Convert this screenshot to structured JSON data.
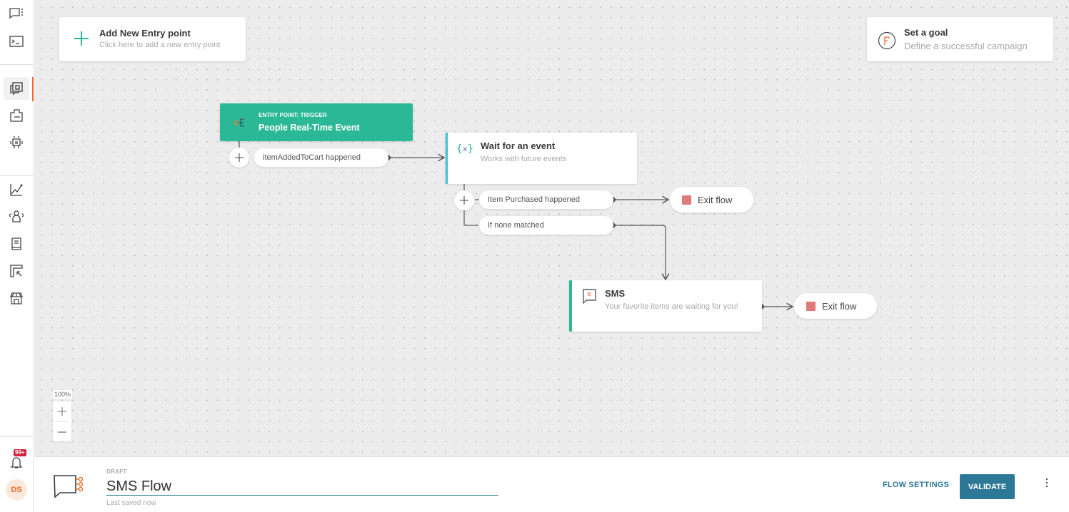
{
  "sidebar": {
    "items": [
      {
        "name": "chat-menu-icon"
      },
      {
        "name": "terminal-icon"
      },
      {
        "name": "journeys-icon",
        "active": true
      },
      {
        "name": "templates-icon"
      },
      {
        "name": "bot-icon"
      },
      {
        "name": "analytics-icon"
      },
      {
        "name": "people-icon"
      },
      {
        "name": "catalog-icon"
      },
      {
        "name": "import-icon"
      },
      {
        "name": "store-icon"
      }
    ],
    "notifications_badge": "99+",
    "avatar_initials": "DS",
    "accent": "#ef6a2c"
  },
  "canvas": {
    "add_entry": {
      "title": "Add New Entry point",
      "subtitle": "Click here to add a new entry point"
    },
    "goal": {
      "title": "Set a goal",
      "subtitle": "Define a successful campaign"
    },
    "trigger": {
      "label": "ENTRY POINT: TRIGGER",
      "title": "People Real-Time Event",
      "color": "#2bb896"
    },
    "trigger_branch": "itemAddedToCart happened",
    "wait_node": {
      "title": "Wait for an event",
      "subtitle": "Works with future events",
      "icon": "{×}"
    },
    "wait_branches": [
      "Item Purchased happened",
      "If none matched"
    ],
    "sms_node": {
      "title": "SMS",
      "subtitle": "Your favorite items are waiting for you!"
    },
    "exit_label": "Exit flow",
    "exit_color": "#e07b7b",
    "zoom_level": "100%"
  },
  "bottom": {
    "status": "DRAFT",
    "flow_name": "SMS Flow",
    "saved": "Last saved now",
    "flow_settings": "FLOW SETTINGS",
    "validate": "VALIDATE",
    "primary_color": "#2d7797"
  }
}
